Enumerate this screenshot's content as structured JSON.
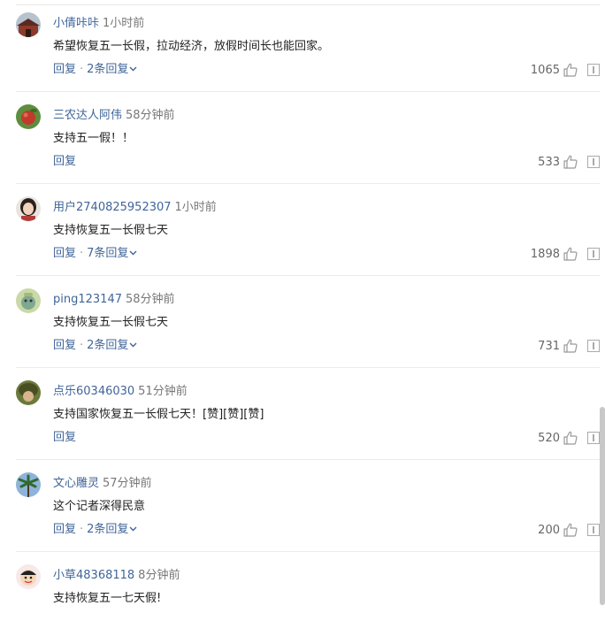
{
  "comments": [
    {
      "user": "小倩咔咔",
      "time": "1小时前",
      "text": "希望恢复五一长假，拉动经济，放假时间长也能回家。",
      "reply": "回复",
      "sep": "·",
      "replies": "2条回复",
      "likes": "1065",
      "avatar": "avatar-building"
    },
    {
      "user": "三农达人阿伟",
      "time": "58分钟前",
      "text": "支持五一假！！",
      "reply": "回复",
      "sep": "",
      "replies": "",
      "likes": "533",
      "avatar": "avatar-fruit"
    },
    {
      "user": "用户2740825952307",
      "time": "1小时前",
      "text": "支持恢复五一长假七天",
      "reply": "回复",
      "sep": "·",
      "replies": "7条回复",
      "likes": "1898",
      "avatar": "avatar-girl"
    },
    {
      "user": "ping123147",
      "time": "58分钟前",
      "text": "支持恢复五一长假七天",
      "reply": "回复",
      "sep": "·",
      "replies": "2条回复",
      "likes": "731",
      "avatar": "avatar-cartoon"
    },
    {
      "user": "点乐60346030",
      "time": "51分钟前",
      "text": "支持国家恢复五一长假七天！[赞][赞][赞]",
      "reply": "回复",
      "sep": "",
      "replies": "",
      "likes": "520",
      "avatar": "avatar-helmet"
    },
    {
      "user": "文心雕灵",
      "time": "57分钟前",
      "text": "这个记者深得民意",
      "reply": "回复",
      "sep": "·",
      "replies": "2条回复",
      "likes": "200",
      "avatar": "avatar-palm"
    },
    {
      "user": "小草48368118",
      "time": "8分钟前",
      "text": "支持恢复五一七天假!",
      "reply": "",
      "sep": "",
      "replies": "",
      "likes": "",
      "avatar": "avatar-smiley"
    }
  ],
  "colors": {
    "link": "#406599",
    "text": "#222222",
    "muted": "#777777"
  }
}
